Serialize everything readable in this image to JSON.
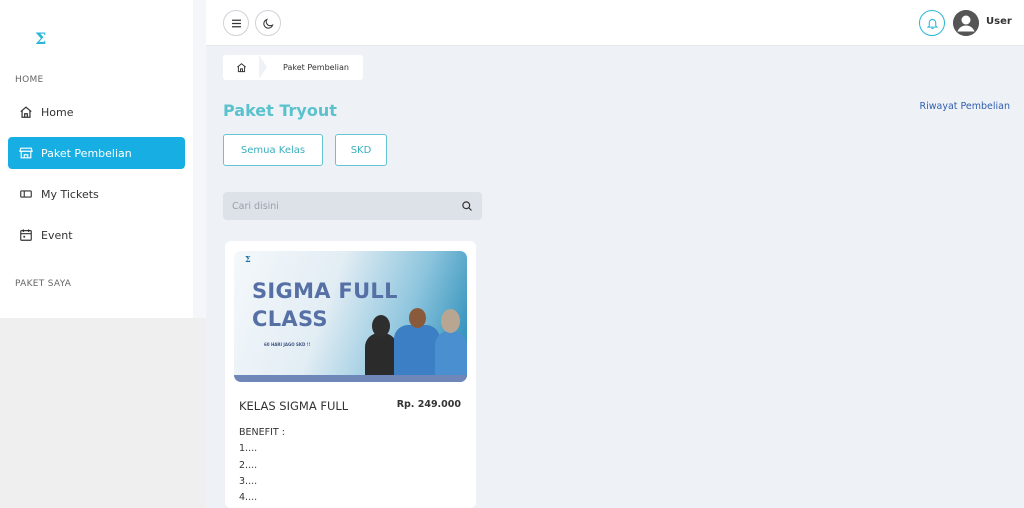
{
  "sidebar": {
    "logo": "Σ",
    "home_heading": "HOME",
    "items": [
      {
        "label": "Home",
        "icon": "home-icon"
      },
      {
        "label": "Paket Pembelian",
        "icon": "store-icon",
        "active": true
      },
      {
        "label": "My Tickets",
        "icon": "ticket-icon"
      },
      {
        "label": "Event",
        "icon": "calendar-icon"
      }
    ],
    "paket_heading": "PAKET SAYA"
  },
  "topbar": {
    "user_label": "User",
    "icons": [
      "menu-icon",
      "moon-icon",
      "bell-icon",
      "user-avatar-icon"
    ]
  },
  "breadcrumb": {
    "current": "Paket Pembelian"
  },
  "page": {
    "title": "Paket Tryout",
    "history_link": "Riwayat Pembelian",
    "filters": [
      "Semua Kelas",
      "SKD"
    ]
  },
  "search": {
    "placeholder": "Cari disini"
  },
  "product": {
    "banner_logo": "Σ",
    "banner_title_line1": "SIGMA FULL",
    "banner_title_line2": "CLASS",
    "banner_subtitle": "60 HARI JAGO SKD !!",
    "name": "KELAS SIGMA FULL",
    "price": "Rp. 249.000",
    "benefit_title": "BENEFIT :",
    "benefits": [
      "1....",
      "2....",
      "3....",
      "4...."
    ]
  },
  "colors": {
    "accent": "#16aee3",
    "title": "#5bc2cd",
    "link": "#2f5fb0"
  }
}
